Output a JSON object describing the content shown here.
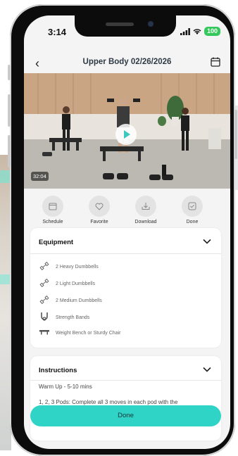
{
  "status": {
    "time": "3:14",
    "battery": "100"
  },
  "header": {
    "title": "Upper Body 02/26/2026"
  },
  "video": {
    "duration": "32:04"
  },
  "actions": [
    {
      "label": "Schedule",
      "icon": "calendar-icon"
    },
    {
      "label": "Favorite",
      "icon": "heart-icon"
    },
    {
      "label": "Download",
      "icon": "download-icon"
    },
    {
      "label": "Done",
      "icon": "check-icon"
    }
  ],
  "equipment": {
    "title": "Equipment",
    "items": [
      {
        "label": "2 Heavy Dumbbells",
        "icon": "dumbbell-icon"
      },
      {
        "label": "2 Light Dumbbells",
        "icon": "dumbbell-icon"
      },
      {
        "label": "2 Medium Dumbbells",
        "icon": "dumbbell-icon"
      },
      {
        "label": "Strength Bands",
        "icon": "band-icon"
      },
      {
        "label": "Weight Bench or Sturdy Chair",
        "icon": "bench-icon"
      }
    ]
  },
  "instructions": {
    "title": "Instructions",
    "lines": [
      "Warm Up - 5-10 mins",
      "1, 2, 3 Pods: Complete all 3 moves in each pod with the"
    ]
  },
  "done_button": {
    "label": "Done"
  },
  "colors": {
    "accent": "#2fd4c6",
    "play_accent": "#3cc8bd"
  }
}
